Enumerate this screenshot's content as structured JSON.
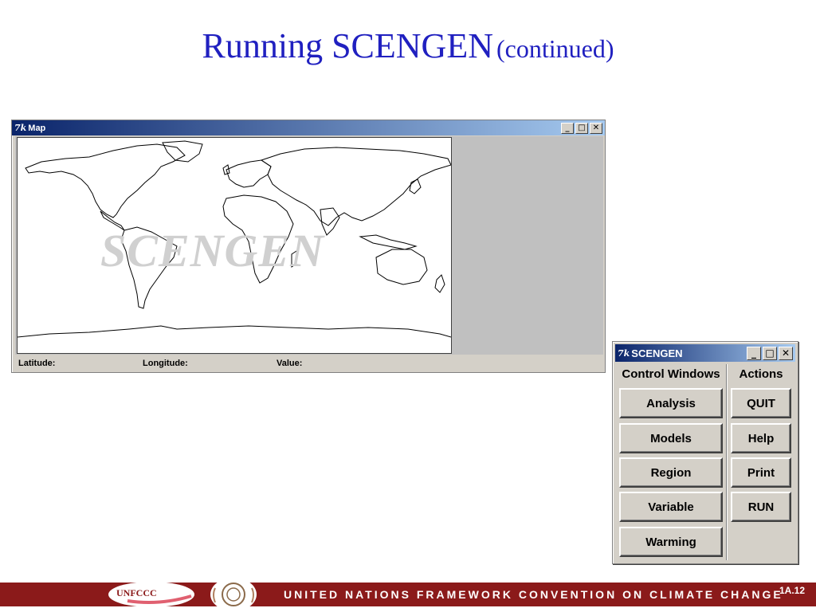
{
  "slide": {
    "title_main": "Running SCENGEN",
    "title_sub": "(continued)"
  },
  "map_window": {
    "title": "Map",
    "app_glyph": "7k",
    "watermark": "SCENGEN",
    "status": {
      "latitude_label": "Latitude:",
      "longitude_label": "Longitude:",
      "value_label": "Value:"
    },
    "controls": {
      "minimize": "_",
      "maximize": "□",
      "close": "✕"
    }
  },
  "scengen_window": {
    "title": "SCENGEN",
    "app_glyph": "7k",
    "controls": {
      "minimize": "_",
      "maximize": "□",
      "close": "✕"
    },
    "control_windows_header": "Control Windows",
    "actions_header": "Actions",
    "control_buttons": [
      "Analysis",
      "Models",
      "Region",
      "Variable",
      "Warming"
    ],
    "action_buttons": [
      "QUIT",
      "Help",
      "Print",
      "RUN"
    ]
  },
  "footer": {
    "org_logo_text": "UNFCCC",
    "banner_text": "UNITED NATIONS FRAMEWORK CONVENTION ON CLIMATE CHANGE",
    "slide_number": "1A.12"
  },
  "colors": {
    "title_blue": "#2020c0",
    "footer_red": "#8b1a1a",
    "window_gray": "#d4d0c8",
    "titlebar_dark": "#0a246a",
    "titlebar_light": "#a6caf0"
  }
}
